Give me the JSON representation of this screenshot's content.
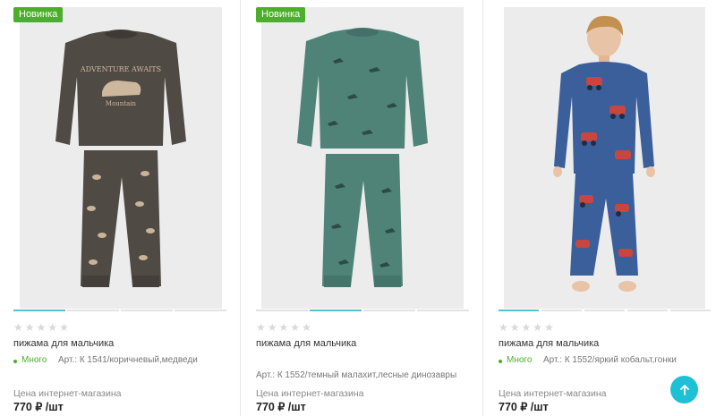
{
  "products": [
    {
      "badge": "Новинка",
      "title": "пижама для мальчика",
      "stock": "Много",
      "article": "Арт.: К 1541/коричневый,медведи",
      "price_label": "Цена интернет-магазина",
      "price": "770 ₽ /шт",
      "rating_stars": 5,
      "image_icon": "pajama-brown-bears-photo",
      "colors": {
        "top": "#504a45",
        "print": "#c9b49a"
      }
    },
    {
      "badge": "Новинка",
      "title": "пижама для мальчика",
      "stock": "",
      "article": "Арт.: К 1552/темный малахит,лесные динозавры",
      "price_label": "Цена интернет-магазина",
      "price": "770 ₽ /шт",
      "rating_stars": 5,
      "image_icon": "pajama-green-dinosaurs-photo",
      "colors": {
        "top": "#4f8378",
        "print": "#2e4a45"
      }
    },
    {
      "badge": "",
      "title": "пижама для мальчика",
      "stock": "Много",
      "article": "Арт.: К 1552/яркий кобальт,гонки",
      "price_label": "Цена интернет-магазина",
      "price": "770 ₽ /шт",
      "rating_stars": 5,
      "image_icon": "boy-in-blue-pajama-photo",
      "colors": {
        "top": "#3b5f9a",
        "print": "#c8463f"
      }
    }
  ],
  "scroll_top_icon": "arrow-up-icon",
  "colors": {
    "accent": "#1ec0d6",
    "badge": "#4caf28",
    "stock": "#4caf28"
  }
}
